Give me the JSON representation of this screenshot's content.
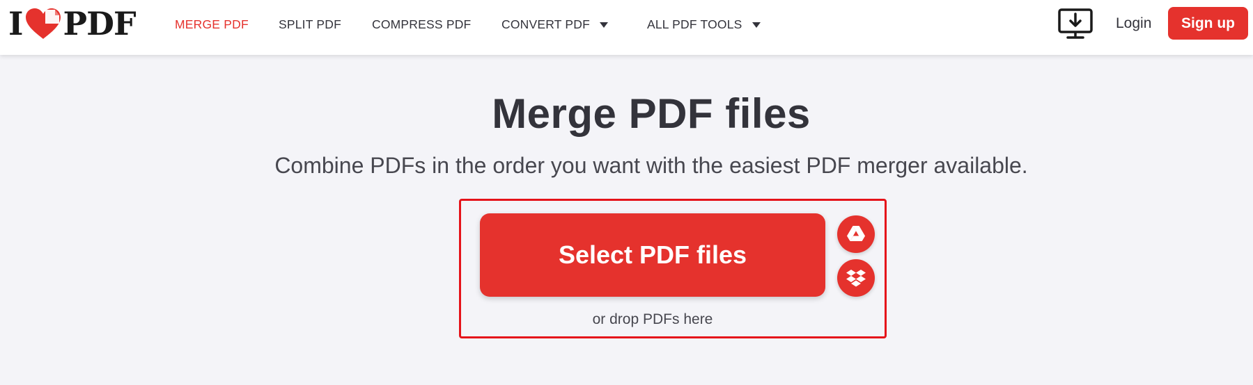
{
  "logo": {
    "left_text": "I",
    "right_text": "PDF",
    "icon": "heart-icon"
  },
  "nav": {
    "items": [
      {
        "label": "MERGE PDF",
        "active": true
      },
      {
        "label": "SPLIT PDF"
      },
      {
        "label": "COMPRESS PDF"
      },
      {
        "label": "CONVERT PDF",
        "has_dropdown": true
      },
      {
        "label": "ALL PDF TOOLS",
        "has_dropdown": true
      }
    ]
  },
  "header": {
    "desktop_icon": "desktop-download-icon",
    "login_label": "Login",
    "signup_label": "Sign up"
  },
  "main": {
    "title": "Merge PDF files",
    "subtitle": "Combine PDFs in the order you want with the easiest PDF merger available.",
    "select_label": "Select PDF files",
    "drop_hint": "or drop PDFs here",
    "cloud_buttons": [
      {
        "icon": "google-drive-icon"
      },
      {
        "icon": "dropbox-icon"
      }
    ]
  },
  "colors": {
    "brand_red": "#e5322d",
    "highlight_border": "#e5131a",
    "text_dark": "#33333b",
    "background": "#f4f4f8"
  }
}
